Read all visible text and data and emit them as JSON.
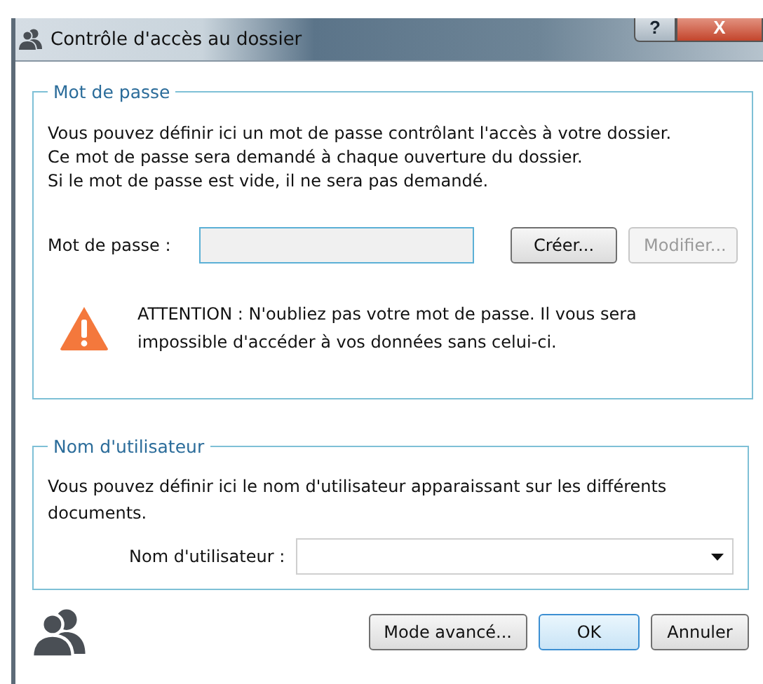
{
  "window": {
    "title": "Contrôle d'accès au dossier",
    "help_glyph": "?",
    "close_glyph": "X"
  },
  "password_group": {
    "legend": "Mot de passe",
    "description": [
      "Vous pouvez définir ici un mot de passe contrôlant l'accès à votre dossier.",
      "Ce mot de passe sera demandé à chaque ouverture du dossier.",
      "Si le mot de passe est vide, il ne sera pas demandé."
    ],
    "field_label": "Mot de passe :",
    "field_disabled": true,
    "buttons": [
      {
        "label": "Créer...",
        "disabled": false
      },
      {
        "label": "Modifier...",
        "disabled": true
      }
    ],
    "warning": "ATTENTION : N'oubliez pas votre mot de passe. Il vous sera impossible d'accéder à vos données sans celui-ci."
  },
  "user_group": {
    "legend": "Nom d'utilisateur",
    "description": "Vous pouvez définir ici le nom d'utilisateur apparaissant sur les différents documents.",
    "field_label": "Nom d'utilisateur :"
  },
  "footer_buttons": [
    {
      "label": "Mode avancé...",
      "default": false
    },
    {
      "label": "OK",
      "default": true
    },
    {
      "label": "Annuler",
      "default": false
    }
  ]
}
